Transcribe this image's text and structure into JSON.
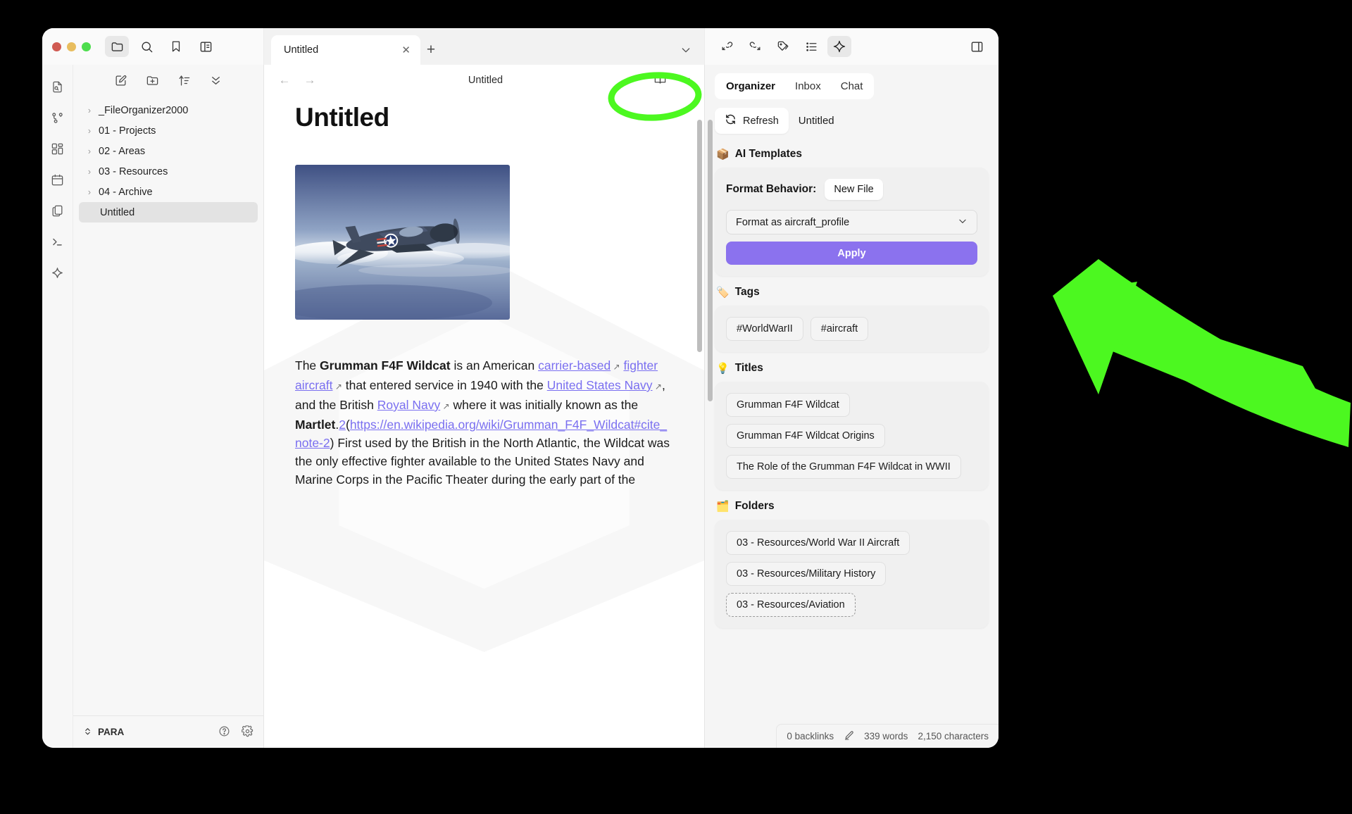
{
  "window": {
    "titlebar_icons": [
      "folder-icon",
      "search-icon",
      "bookmark-icon",
      "panel-layout-icon"
    ],
    "tab": {
      "label": "Untitled",
      "close": "✕",
      "new_tab": "+"
    }
  },
  "ribbon": {
    "items": [
      {
        "name": "file-search-icon"
      },
      {
        "name": "graph-view-icon"
      },
      {
        "name": "canvas-icon"
      },
      {
        "name": "calendar-icon"
      },
      {
        "name": "copy-files-icon"
      },
      {
        "name": "terminal-icon"
      },
      {
        "name": "ai-sparkle-icon"
      }
    ]
  },
  "explorer": {
    "toolbar": [
      "new-note-icon",
      "new-folder-icon",
      "sort-icon",
      "collapse-icon"
    ],
    "items": [
      {
        "label": "_FileOrganizer2000",
        "type": "folder",
        "selected": false
      },
      {
        "label": "01 - Projects",
        "type": "folder",
        "selected": false
      },
      {
        "label": "02 - Areas",
        "type": "folder",
        "selected": false
      },
      {
        "label": "03 - Resources",
        "type": "folder",
        "selected": false
      },
      {
        "label": "04 - Archive",
        "type": "folder",
        "selected": false
      },
      {
        "label": "Untitled",
        "type": "file",
        "selected": true
      }
    ],
    "footer": {
      "vault": "PARA",
      "help": "?",
      "settings": "gear"
    }
  },
  "editor": {
    "header_title": "Untitled",
    "back": "←",
    "forward": "→",
    "reading_mode": "book-icon",
    "more": "…",
    "doc_title": "Untitled",
    "image_alt": "Grumman F4F Wildcat fighter aircraft in flight over clouds",
    "paragraph": {
      "s1": "The ",
      "b1": "Grumman F4F Wildcat",
      "s2": " is an American ",
      "l1": "carrier-based",
      "s3": " ",
      "l2": "fighter aircraft",
      "s4": " that entered service in 1940 with the ",
      "l3": "United States Navy",
      "s5": ", and the British ",
      "l4": "Royal Navy",
      "s6": " where it was initially known as the ",
      "b2": "Martlet",
      "s7": ".",
      "l5": "2",
      "s8": "(",
      "l6": "https://en.wikipedia.org/wiki/Grumman_F4F_Wildcat#cite_note-2",
      "s9": ") First used by the British in the North Atlantic, the Wildcat was the only effective fighter available to the United States Navy and Marine Corps in the Pacific Theater during the early part of the"
    }
  },
  "right_panel": {
    "toolbar_icons": [
      "backlink-icon",
      "outgoing-link-icon",
      "tags-icon",
      "outline-list-icon",
      "ai-sparkle-icon",
      "right-sidebar-toggle-icon"
    ],
    "tabs": [
      {
        "label": "Organizer",
        "active": true
      },
      {
        "label": "Inbox",
        "active": false
      },
      {
        "label": "Chat",
        "active": false
      }
    ],
    "refresh_label": "Refresh",
    "refresh_icon": "refresh-icon",
    "current_file": "Untitled",
    "sections": {
      "ai_templates": {
        "emoji": "📦",
        "title": "AI Templates",
        "format_behavior_label": "Format Behavior:",
        "format_behavior_value": "New File",
        "select_value": "Format as aircraft_profile",
        "apply_label": "Apply",
        "apply_color": "#8b72ee"
      },
      "tags": {
        "emoji": "🏷️",
        "title": "Tags",
        "items": [
          "#WorldWarII",
          "#aircraft"
        ]
      },
      "titles": {
        "emoji": "💡",
        "title": "Titles",
        "items": [
          "Grumman F4F Wildcat",
          "Grumman F4F Wildcat Origins",
          "The Role of the Grumman F4F Wildcat in WWII"
        ]
      },
      "folders": {
        "emoji": "🗂️",
        "title": "Folders",
        "items": [
          {
            "label": "03 - Resources/World War II Aircraft",
            "style": "solid"
          },
          {
            "label": "03 - Resources/Military History",
            "style": "solid"
          },
          {
            "label": "03 - Resources/Aviation",
            "style": "dashed"
          }
        ]
      }
    }
  },
  "status_bar": {
    "backlinks": "0 backlinks",
    "edit_icon": "pencil-icon",
    "words": "339 words",
    "characters": "2,150 characters"
  },
  "annotation": {
    "color": "#4cf820",
    "circle_target": "Organizer",
    "arrow_direction": "left"
  }
}
